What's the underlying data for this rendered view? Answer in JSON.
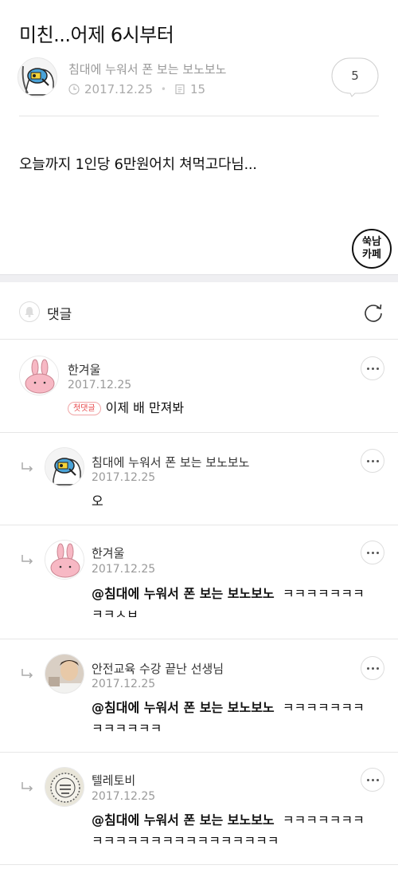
{
  "post": {
    "title": "미친...어제 6시부터",
    "author": "침대에 누워서 폰 보는 보노보노",
    "date": "2017.12.25",
    "views": "15",
    "comment_count": "5",
    "body": "오늘까지 1인당 6만원어치 쳐먹고다님..."
  },
  "cafe_logo": {
    "line1": "쑥남",
    "line2": "카페"
  },
  "comments_header": {
    "label": "댓글",
    "bell_icon": "bell-icon",
    "refresh_icon": "refresh-icon"
  },
  "comments": [
    {
      "name": "한겨울",
      "date": "2017.12.25",
      "badge": "첫댓글",
      "mention": "",
      "text": "이제 배 만져봐"
    },
    {
      "name": "침대에 누워서 폰 보는 보노보노",
      "date": "2017.12.25",
      "mention": "",
      "text": "오"
    },
    {
      "name": "한겨울",
      "date": "2017.12.25",
      "mention": "@침대에 누워서 폰 보는 보노보노",
      "text": "ㅋㅋㅋㅋㅋㅋㅋ",
      "text2": "ㅋㅋㅅㅂ"
    },
    {
      "name": "안전교육 수강 끝난 선생님",
      "date": "2017.12.25",
      "mention": "@침대에 누워서 폰 보는 보노보노",
      "text": "ㅋㅋㅋㅋㅋㅋㅋ",
      "text2": "ㅋㅋㅋㅋㅋㅋ"
    },
    {
      "name": "텔레토비",
      "date": "2017.12.25",
      "mention": "@침대에 누워서 폰 보는 보노보노",
      "text": "ㅋㅋㅋㅋㅋㅋㅋ",
      "text2": "ㅋㅋㅋㅋㅋㅋㅋㅋㅋㅋㅋㅋㅋㅋㅋㅋ"
    }
  ],
  "colors": {
    "badge": "#e8484b",
    "divider": "#e6e6e6",
    "section_gap": "#efeff2"
  }
}
